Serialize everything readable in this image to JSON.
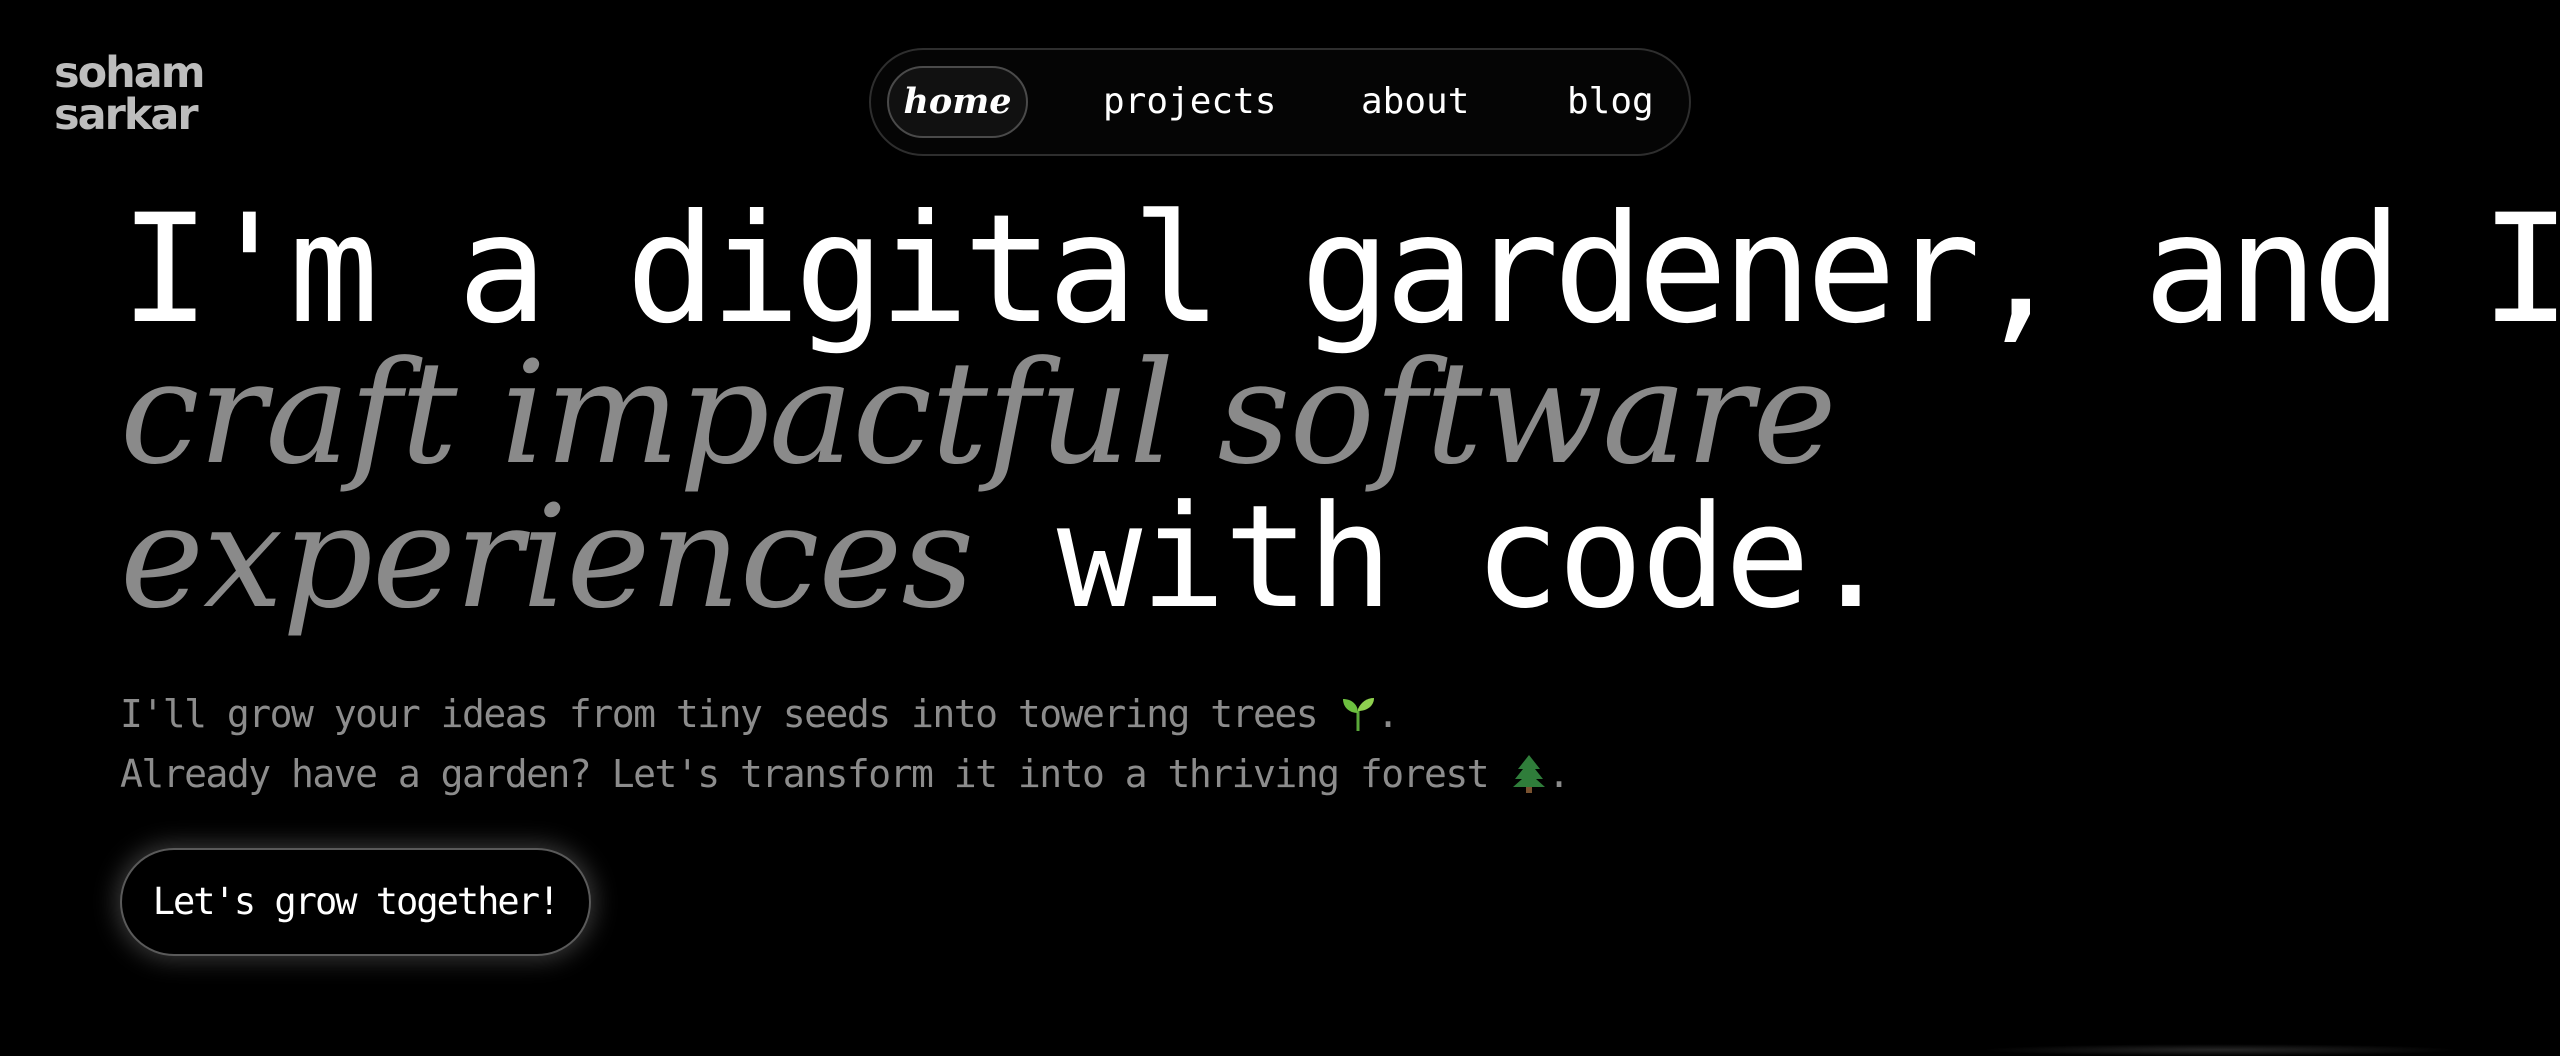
{
  "logo": {
    "line1": "soham",
    "line2": "sarkar"
  },
  "nav": {
    "items": [
      {
        "label": "home",
        "active": true
      },
      {
        "label": "projects",
        "active": false
      },
      {
        "label": "about",
        "active": false
      },
      {
        "label": "blog",
        "active": false
      }
    ]
  },
  "hero": {
    "line1": "I'm a digital gardener, and I",
    "line2": "craft impactful software",
    "line3_fancy": "experiences",
    "line3_plain": "with code."
  },
  "subtext": {
    "line1": "I'll grow your ideas from tiny seeds into towering trees",
    "line1_end": ".",
    "line1_icon": "seedling-icon",
    "line2": "Already have a garden? Let's transform it into a thriving forest",
    "line2_end": ".",
    "line2_icon": "evergreen-tree-icon"
  },
  "cta": {
    "label": "Let's grow together!"
  },
  "colors": {
    "background": "#000000",
    "text_primary": "#ffffff",
    "text_muted": "#8a8a8a",
    "logo": "#bdbdbd"
  }
}
